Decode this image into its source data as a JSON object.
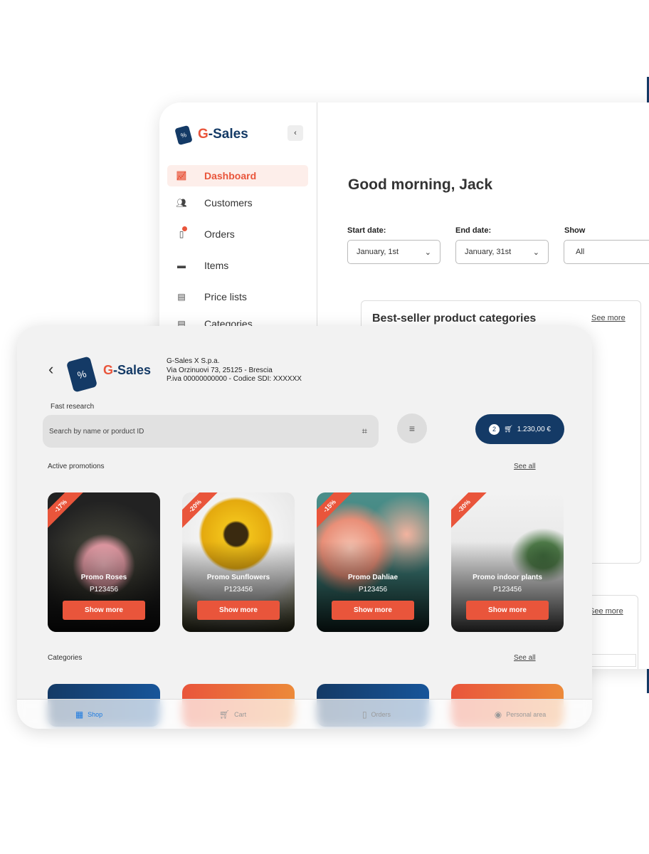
{
  "dashboard": {
    "brand_g": "G",
    "brand_rest": "-Sales",
    "collapse_icon": "chevron-left-icon",
    "nav": [
      {
        "label": "Dashboard",
        "icon": "chart-line-icon",
        "active": true
      },
      {
        "label": "Customers",
        "icon": "users-icon"
      },
      {
        "label": "Orders",
        "icon": "clipboard-icon",
        "notification": true
      },
      {
        "label": "Items",
        "icon": "store-icon"
      },
      {
        "label": "Price lists",
        "icon": "price-list-icon"
      },
      {
        "label": "Categories",
        "icon": "categories-icon"
      }
    ],
    "greeting": "Good morning, Jack",
    "filters": {
      "start_label": "Start date:",
      "start_value": "January, 1st",
      "end_label": "End date:",
      "end_value": "January, 31st",
      "show_label": "Show",
      "show_value": "All"
    },
    "bestseller_title": "Best-seller product categories",
    "see_more": "See more",
    "see_more_2": "See more"
  },
  "shop": {
    "brand_g": "G",
    "brand_rest": "-Sales",
    "company": [
      "G-Sales X S.p.a.",
      "Via Orzinuovi 73, 25125 - Brescia",
      "P.iva 00000000000 - Codice SDI: XXXXXX"
    ],
    "search_label": "Fast research",
    "search_placeholder": "Search by name or porduct ID",
    "cart": {
      "count": "2",
      "total": "1.230,00 €"
    },
    "promotions_title": "Active promotions",
    "see_all": "See all",
    "promotions": [
      {
        "title": "Promo Roses",
        "code": "P123456",
        "discount": "-17%",
        "button": "Show more"
      },
      {
        "title": "Promo Sunflowers",
        "code": "P123456",
        "discount": "-20%",
        "button": "Show more"
      },
      {
        "title": "Promo Dahliae",
        "code": "P123456",
        "discount": "-15%",
        "button": "Show more"
      },
      {
        "title": "Promo indoor plants",
        "code": "P123456",
        "discount": "-30%",
        "button": "Show more"
      }
    ],
    "categories_title": "Categories",
    "categories_see_all": "See all",
    "tabs": [
      {
        "label": "Shop",
        "icon": "grid-icon",
        "active": true
      },
      {
        "label": "Cart",
        "icon": "cart-icon"
      },
      {
        "label": "Orders",
        "icon": "clipboard-icon"
      },
      {
        "label": "Personal area",
        "icon": "user-circle-icon"
      }
    ]
  },
  "colors": {
    "brand_blue": "#143a66",
    "accent": "#e9553b",
    "active_tab": "#1e7be0"
  }
}
